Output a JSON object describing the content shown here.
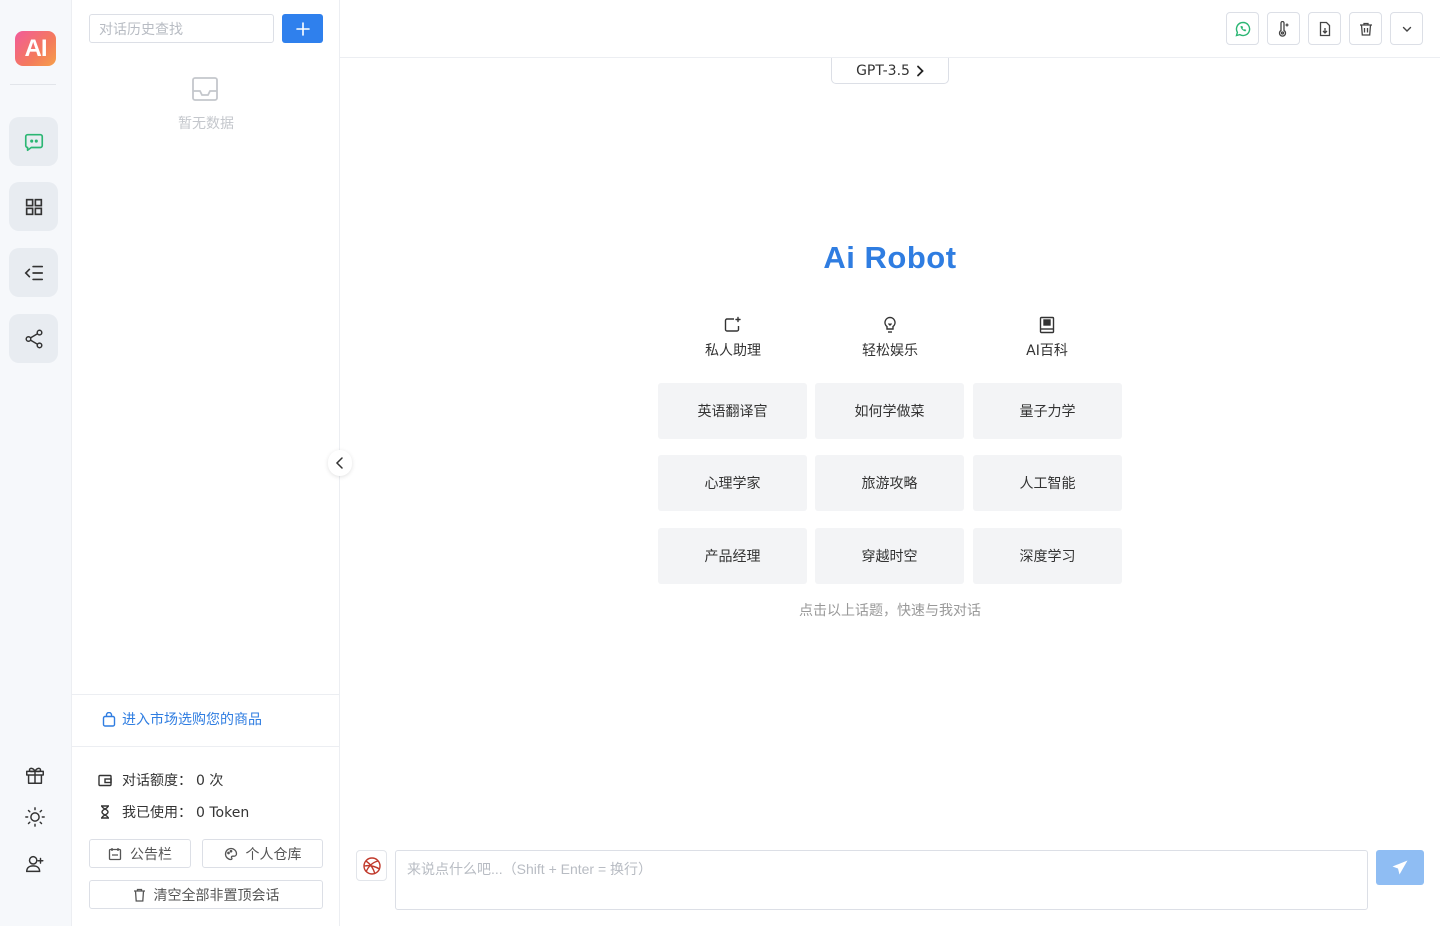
{
  "app": {
    "logo_text": "AI"
  },
  "rail": {
    "items": [
      {
        "name": "chat",
        "icon": "chat-bubble-icon",
        "active": true
      },
      {
        "name": "apps",
        "icon": "grid-icon"
      },
      {
        "name": "menu",
        "icon": "list-indent-icon"
      },
      {
        "name": "share",
        "icon": "share-icon"
      }
    ],
    "bottom": [
      "gift-icon",
      "sun-icon",
      "user-icon"
    ]
  },
  "sidebar": {
    "search_placeholder": "对话历史查找",
    "add_label": "+",
    "empty_text": "暂无数据",
    "market_link": "进入市场选购您的商品",
    "quota_label": "对话额度：",
    "quota_value": "0 次",
    "used_label": "我已使用：",
    "used_value": "0 Token",
    "notice_button": "公告栏",
    "repo_button": "个人仓库",
    "clear_button": "清空全部非置顶会话"
  },
  "toolbar": {
    "buttons": [
      "whatsapp-icon",
      "thermometer-icon",
      "file-export-icon",
      "trash-icon",
      "chevron-down-icon"
    ]
  },
  "main": {
    "model_label": "GPT-3.5",
    "title": "Ai Robot",
    "categories": [
      {
        "label": "私人助理",
        "icon": "assistant-icon"
      },
      {
        "label": "轻松娱乐",
        "icon": "lightbulb-icon"
      },
      {
        "label": "AI百科",
        "icon": "book-icon"
      }
    ],
    "topics": [
      [
        "英语翻译官",
        "如何学做菜",
        "量子力学"
      ],
      [
        "心理学家",
        "旅游攻略",
        "人工智能"
      ],
      [
        "产品经理",
        "穿越时空",
        "深度学习"
      ]
    ],
    "hint": "点击以上话题，快速与我对话",
    "input_placeholder": "来说点什么吧...（Shift + Enter = 换行）"
  },
  "colors": {
    "accent": "#2f7de1",
    "send_disabled": "#8fbdf3",
    "logo_gradient_start": "#f25b9a",
    "logo_gradient_end": "#f6a04a"
  }
}
